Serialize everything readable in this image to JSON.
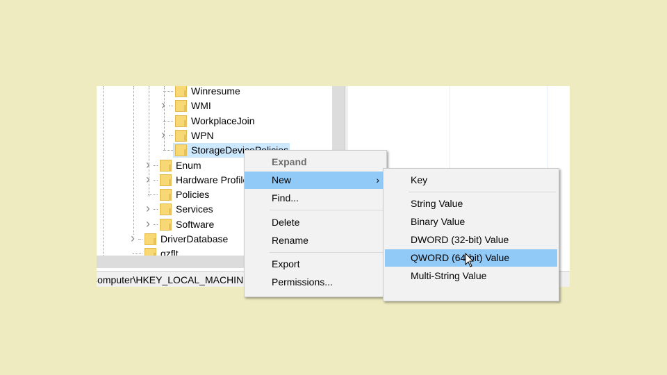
{
  "tree": {
    "items": [
      {
        "label": "Winresume",
        "level": 3,
        "expandable": false
      },
      {
        "label": "WMI",
        "level": 3,
        "expandable": true
      },
      {
        "label": "WorkplaceJoin",
        "level": 3,
        "expandable": false
      },
      {
        "label": "WPN",
        "level": 3,
        "expandable": true
      },
      {
        "label": "StorageDevicePolicies",
        "level": 3,
        "expandable": false,
        "selected": true
      },
      {
        "label": "Enum",
        "level": 2,
        "expandable": true
      },
      {
        "label": "Hardware Profiles",
        "level": 2,
        "expandable": true
      },
      {
        "label": "Policies",
        "level": 2,
        "expandable": false
      },
      {
        "label": "Services",
        "level": 2,
        "expandable": true
      },
      {
        "label": "Software",
        "level": 2,
        "expandable": true
      },
      {
        "label": "DriverDatabase",
        "level": 1,
        "expandable": true
      },
      {
        "label": "gzflt",
        "level": 1,
        "expandable": false
      }
    ]
  },
  "status_bar": {
    "path": "Computer\\HKEY_LOCAL_MACHINE\\SYSTEM"
  },
  "context_menu": {
    "expand": "Expand",
    "new": "New",
    "find": "Find...",
    "delete": "Delete",
    "rename": "Rename",
    "export": "Export",
    "permissions": "Permissions..."
  },
  "submenu": {
    "key": "Key",
    "string": "String Value",
    "binary": "Binary Value",
    "dword": "DWORD (32-bit) Value",
    "qword": "QWORD (64-bit) Value",
    "multistring": "Multi-String Value"
  },
  "colors": {
    "highlight": "#91c9f7",
    "selected": "#cce8ff",
    "background": "#efebc0"
  }
}
